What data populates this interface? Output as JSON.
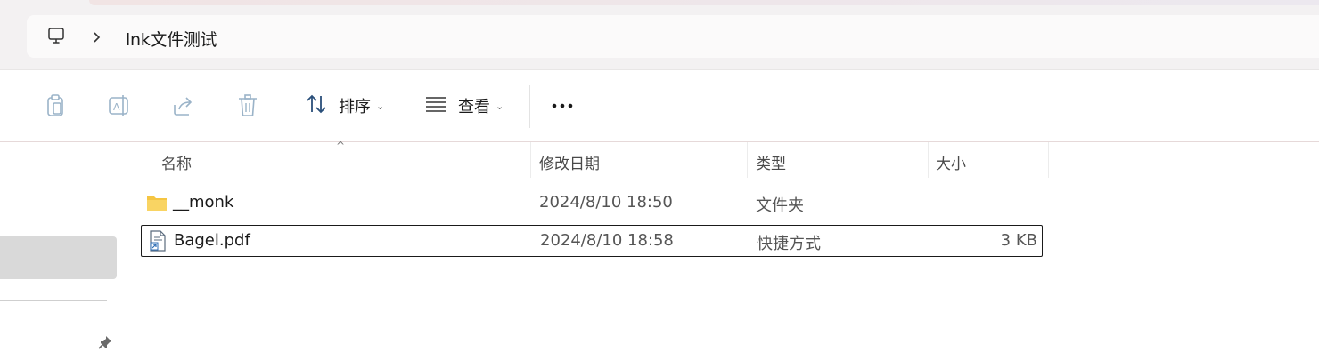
{
  "address_bar": {
    "breadcrumb": "lnk文件测试"
  },
  "toolbar": {
    "sort_label": "排序",
    "view_label": "查看",
    "buttons": [
      "copy-icon",
      "rename-icon",
      "share-icon",
      "delete-icon"
    ]
  },
  "columns": {
    "name": "名称",
    "date": "修改日期",
    "type": "类型",
    "size": "大小"
  },
  "files": [
    {
      "name": "__monk",
      "date": "2024/8/10 18:50",
      "type": "文件夹",
      "size": "",
      "icon": "folder-icon"
    },
    {
      "name": "Bagel.pdf",
      "date": "2024/8/10 18:58",
      "type": "快捷方式",
      "size": "3 KB",
      "icon": "shortcut-file-icon"
    }
  ],
  "colors": {
    "selected_border": "#1a1a1a",
    "sidebar_selected": "#d9d9d9",
    "folder": "#f5c542"
  }
}
